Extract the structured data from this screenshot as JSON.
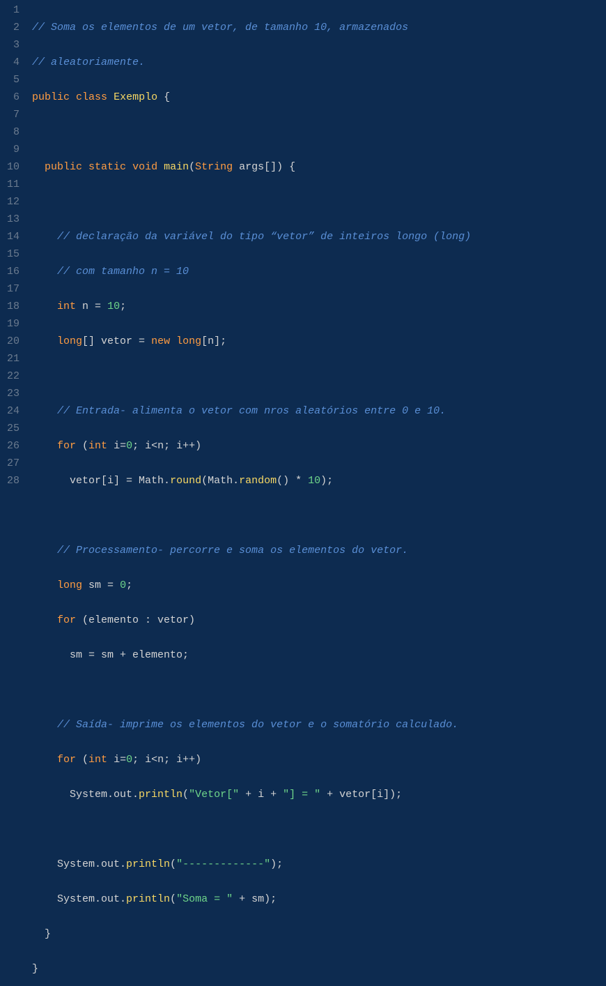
{
  "lineNumbers": [
    "1",
    "2",
    "3",
    "4",
    "5",
    "6",
    "7",
    "8",
    "9",
    "10",
    "11",
    "12",
    "13",
    "14",
    "15",
    "16",
    "17",
    "18",
    "19",
    "20",
    "21",
    "22",
    "23",
    "24",
    "25",
    "26",
    "27",
    "28"
  ],
  "code": {
    "l1": "// Soma os elementos de um vetor, de tamanho 10, armazenados",
    "l2": "// aleatoriamente.",
    "l3_public": "public",
    "l3_class": "class",
    "l3_name": "Exemplo",
    "l3_brace": " {",
    "l5_public": "public",
    "l5_static": "static",
    "l5_void": "void",
    "l5_main": "main",
    "l5_paren1": "(",
    "l5_String": "String",
    "l5_args": " args[]) {",
    "l7": "// declaração da variável do tipo “vetor” de inteiros longo (long)",
    "l8": "// com tamanho n = 10",
    "l9_int": "int",
    "l9_n": " n ",
    "l9_eq": "=",
    "l9_val": "10",
    "l9_semi": ";",
    "l10_long": "long",
    "l10_br": "[] vetor ",
    "l10_eq": "=",
    "l10_new": " new ",
    "l10_long2": "long",
    "l10_rest": "[n];",
    "l12": "// Entrada- alimenta o vetor com nros aleatórios entre 0 e 10.",
    "l13_for": "for",
    "l13_a": " (",
    "l13_int": "int",
    "l13_b": " i=",
    "l13_zero": "0",
    "l13_c": "; i<n; i++)",
    "l14_a": "      vetor[i] ",
    "l14_eq": "=",
    "l14_b": " Math.",
    "l14_round": "round",
    "l14_c": "(Math.",
    "l14_random": "random",
    "l14_d": "() * ",
    "l14_ten": "10",
    "l14_e": ");",
    "l16": "// Processamento- percorre e soma os elementos do vetor.",
    "l17_long": "long",
    "l17_a": " sm ",
    "l17_eq": "=",
    "l17_sp": " ",
    "l17_zero": "0",
    "l17_semi": ";",
    "l18_for": "for",
    "l18_rest": " (elemento : vetor)",
    "l19": "      sm = sm + elemento;",
    "l21": "// Saída- imprime os elementos do vetor e o somatório calculado.",
    "l22_for": "for",
    "l22_a": " (",
    "l22_int": "int",
    "l22_b": " i=",
    "l22_zero": "0",
    "l22_c": "; i<n; i++)",
    "l23_a": "      System.out.",
    "l23_println": "println",
    "l23_b": "(",
    "l23_s1": "\"Vetor[\"",
    "l23_c": " + i + ",
    "l23_s2": "\"] = \"",
    "l23_d": " + vetor[i]);",
    "l25_a": "    System.out.",
    "l25_println": "println",
    "l25_b": "(",
    "l25_s": "\"-------------\"",
    "l25_c": ");",
    "l26_a": "    System.out.",
    "l26_println": "println",
    "l26_b": "(",
    "l26_s": "\"Soma = \"",
    "l26_c": " + sm);",
    "l27": "  }",
    "l28": "}"
  }
}
